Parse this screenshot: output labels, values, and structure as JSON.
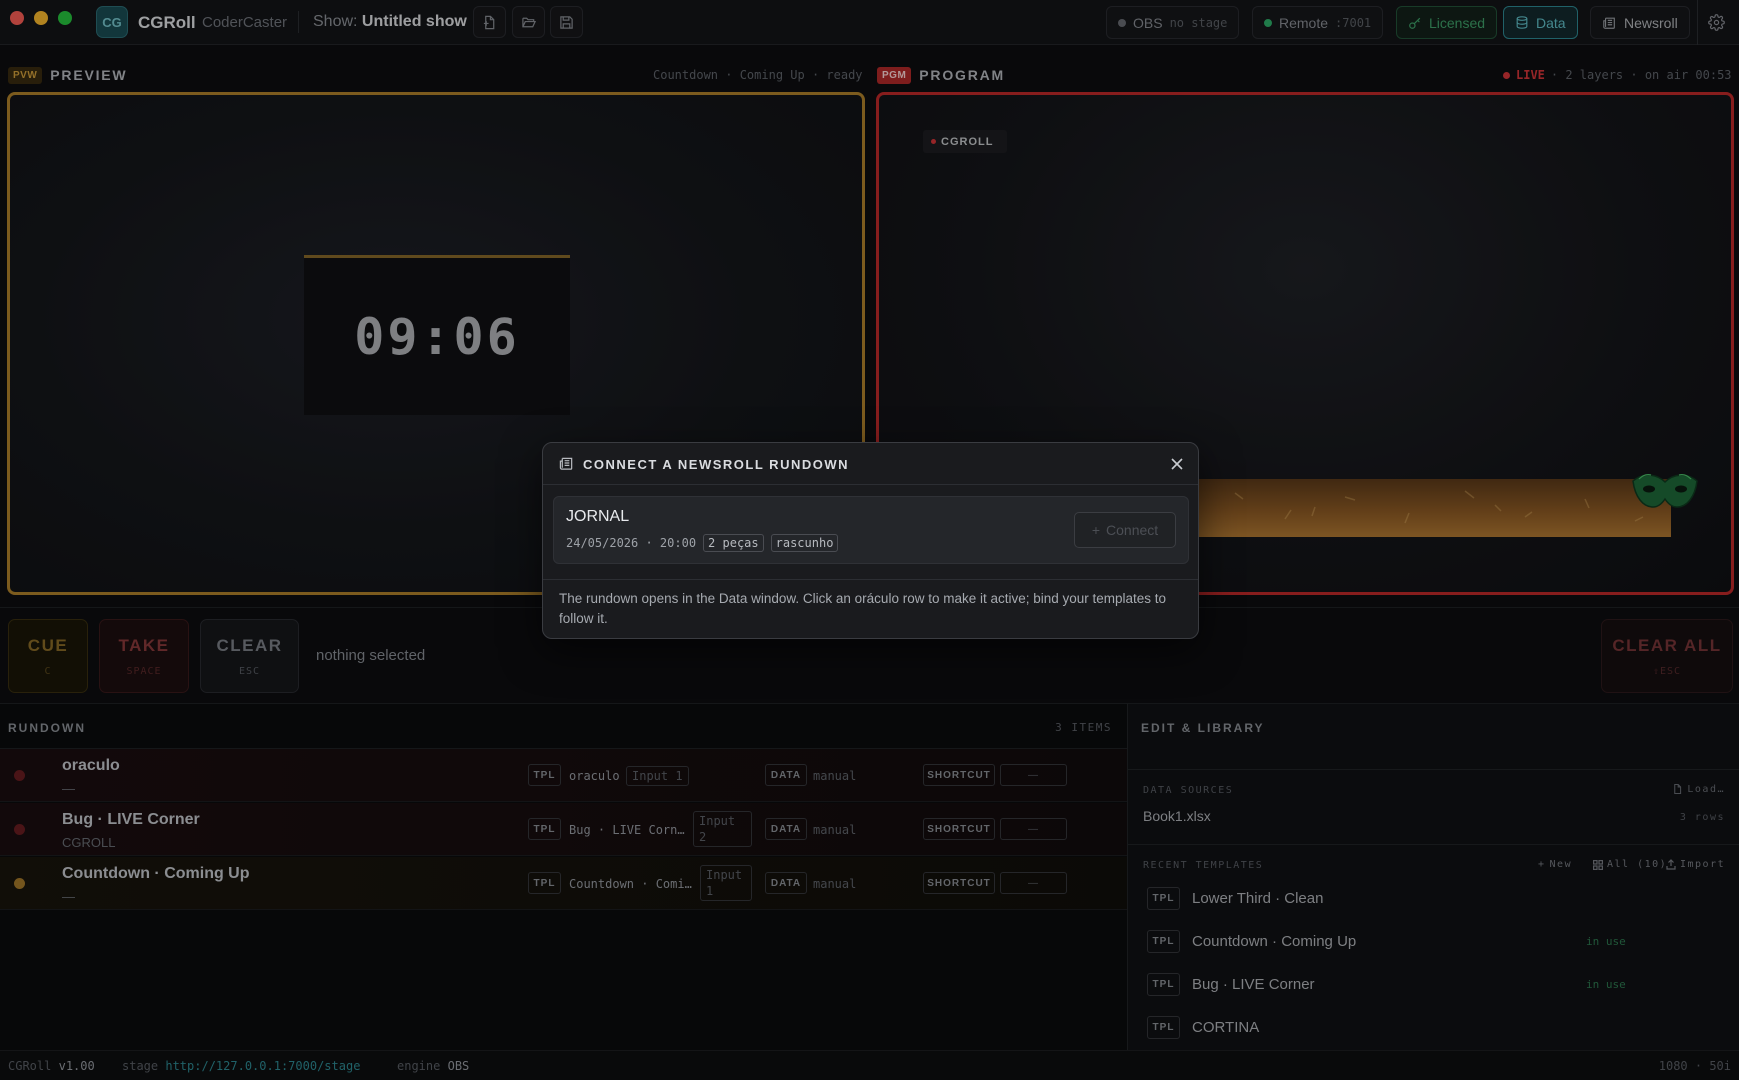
{
  "topbar": {
    "app_name": "CGRoll",
    "app_sub": "CoderCaster",
    "logo_text": "CG",
    "show_label": "Show:",
    "show_name": "Untitled show",
    "obs": {
      "label": "OBS",
      "status": "no stage"
    },
    "remote": {
      "label": "Remote",
      "port": ":7001"
    },
    "licensed": "Licensed",
    "data": "Data",
    "newsroll": "Newsroll"
  },
  "preview": {
    "tag": "PVW",
    "title": "PREVIEW",
    "meta": "Countdown · Coming Up · ready",
    "countdown": "09:06"
  },
  "program": {
    "tag": "PGM",
    "title": "PROGRAM",
    "live": "LIVE",
    "meta": "· 2 layers · on air 00:53",
    "chip": "CGROLL"
  },
  "transport": {
    "cue": {
      "label": "CUE",
      "key": "C"
    },
    "take": {
      "label": "TAKE",
      "key": "SPACE"
    },
    "clear": {
      "label": "CLEAR",
      "key": "ESC"
    },
    "clear_all": {
      "label": "CLEAR ALL",
      "key": "⇧ESC"
    },
    "selection": "nothing selected"
  },
  "rundown": {
    "title": "RUNDOWN",
    "count": "3 ITEMS",
    "rows": [
      {
        "name": "oraculo",
        "sub": "—",
        "tpl": "oraculo",
        "input": "Input 1",
        "data": "manual",
        "shortcut": "—"
      },
      {
        "name": "Bug · LIVE Corner",
        "sub": "CGROLL",
        "tpl": "Bug · LIVE Corn…",
        "input": "Input 2",
        "data": "manual",
        "shortcut": "—"
      },
      {
        "name": "Countdown · Coming Up",
        "sub": "—",
        "tpl": "Countdown · Comi…",
        "input": "Input 1",
        "data": "manual",
        "shortcut": "—"
      }
    ],
    "tpl_badge": "TPL",
    "data_badge": "DATA",
    "shortcut_badge": "SHORTCUT"
  },
  "library": {
    "title": "EDIT & LIBRARY",
    "data_sources_label": "DATA SOURCES",
    "load": "Load…",
    "source_name": "Book1.xlsx",
    "source_rows": "3 rows",
    "recent_label": "RECENT TEMPLATES",
    "new": "New",
    "all": "All (10)",
    "import": "Import",
    "templates": [
      {
        "name": "Lower Third · Clean",
        "status": ""
      },
      {
        "name": "Countdown · Coming Up",
        "status": "in use"
      },
      {
        "name": "Bug · LIVE Corner",
        "status": "in use"
      },
      {
        "name": "CORTINA",
        "status": ""
      }
    ]
  },
  "status": {
    "app": "CGRoll",
    "version": "v1.00",
    "stage_label": "stage",
    "stage_url": "http://127.0.0.1:7000/stage",
    "engine_label": "engine",
    "engine": "OBS",
    "format": "1080 · 50i"
  },
  "modal": {
    "title": "CONNECT A NEWSROLL RUNDOWN",
    "rundown_name": "JORNAL",
    "date": "24/05/2026 · 20:00",
    "pieces": "2 peças",
    "state": "rascunho",
    "connect": "Connect",
    "note": "The rundown opens in the Data window. Click an oráculo row to make it active; bind your templates to follow it."
  },
  "colors": {
    "preview": "#b2832b",
    "program": "#c22a2a",
    "accent_teal": "#2f8c95",
    "licensed_green": "#3a9a66",
    "live_red": "#d9363a"
  }
}
